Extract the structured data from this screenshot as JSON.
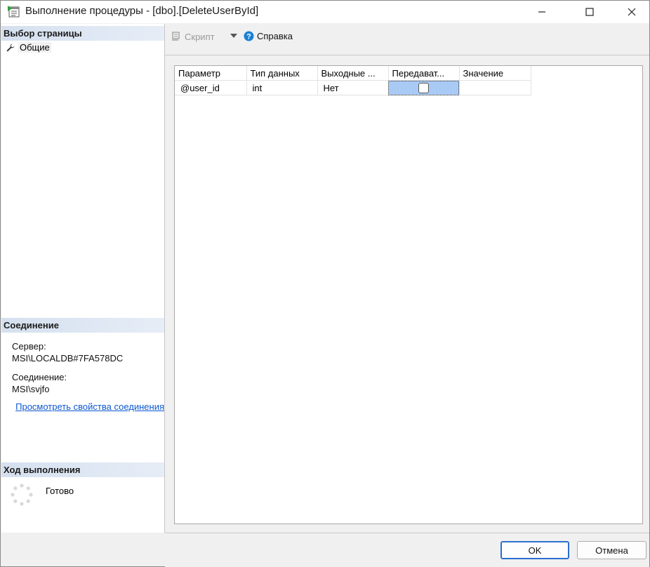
{
  "window": {
    "title": "Выполнение процедуры - [dbo].[DeleteUserById]"
  },
  "sidebar": {
    "page_select_header": "Выбор страницы",
    "pages": [
      {
        "label": "Общие",
        "icon": "wrench-icon"
      }
    ],
    "connection_header": "Соединение",
    "server_label": "Сервер:",
    "server_value": "MSI\\LOCALDB#7FA578DC",
    "connection_label": "Соединение:",
    "connection_value": "MSI\\svjfo",
    "view_properties_link": "Просмотреть свойства соединения",
    "progress_header": "Ход выполнения",
    "progress_status": "Готово"
  },
  "toolbar": {
    "script_label": "Скрипт",
    "help_label": "Справка"
  },
  "grid": {
    "columns": [
      "Параметр",
      "Тип данных",
      "Выходные ...",
      "Передават...",
      "Значение"
    ],
    "rows": [
      {
        "parameter": "@user_id",
        "data_type": "int",
        "output": "Нет",
        "pass_null": false,
        "value": ""
      }
    ]
  },
  "footer": {
    "ok_label": "OK",
    "cancel_label": "Отмена"
  },
  "colors": {
    "accent": "#2a6fd0",
    "selection": "#a9caf4",
    "section_header": "#d5e0ef",
    "link": "#0b57d0"
  }
}
